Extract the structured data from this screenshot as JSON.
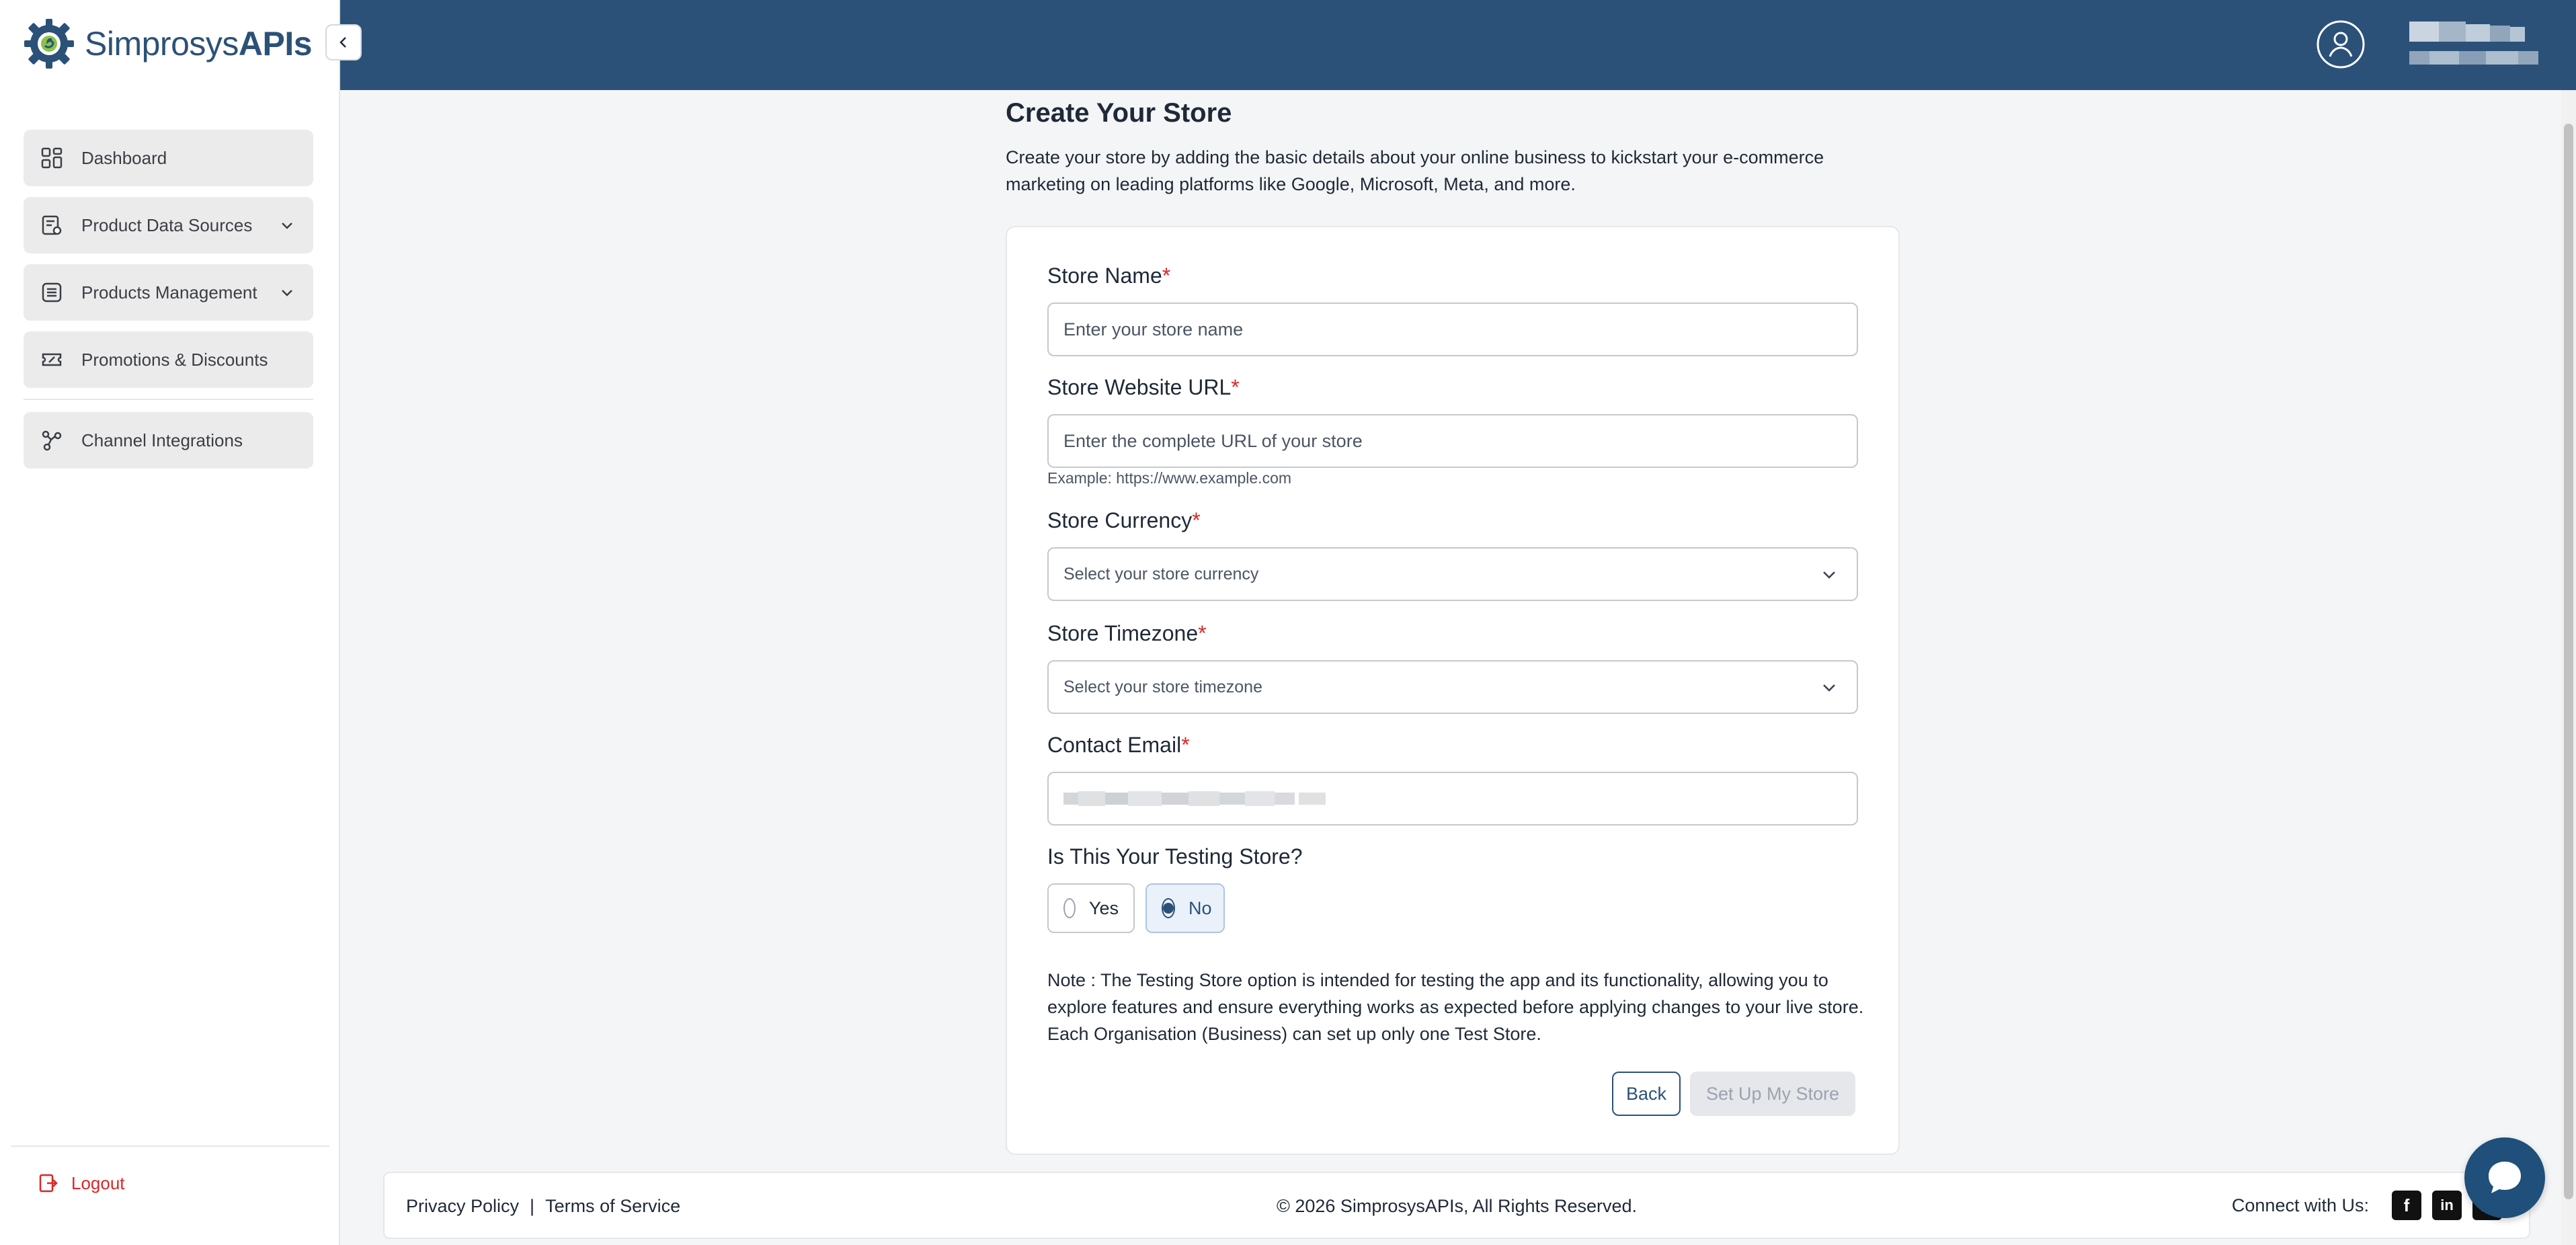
{
  "brand": {
    "name_light": "Simprosys",
    "name_bold": "APIs"
  },
  "sidebar": {
    "items": [
      {
        "label": "Dashboard",
        "icon": "dashboard-icon",
        "expandable": false
      },
      {
        "label": "Product Data Sources",
        "icon": "data-sources-icon",
        "expandable": true
      },
      {
        "label": "Products Management",
        "icon": "products-list-icon",
        "expandable": true
      },
      {
        "label": "Promotions & Discounts",
        "icon": "ticket-icon",
        "expandable": false
      },
      {
        "label": "Channel Integrations",
        "icon": "integrations-icon",
        "expandable": false
      }
    ],
    "logout_label": "Logout"
  },
  "page": {
    "title": "Create Your Store",
    "description": "Create your store by adding the basic details about your online business to kickstart your e-commerce marketing on leading platforms like Google, Microsoft, Meta, and more."
  },
  "form": {
    "required_mark": "*",
    "store_name": {
      "label": "Store Name",
      "placeholder": "Enter your store name"
    },
    "store_url": {
      "label": "Store Website URL",
      "placeholder": "Enter the complete URL of your store",
      "hint": "Example: https://www.example.com"
    },
    "currency": {
      "label": "Store Currency",
      "placeholder": "Select your store currency"
    },
    "timezone": {
      "label": "Store Timezone",
      "placeholder": "Select your store timezone"
    },
    "email": {
      "label": "Contact Email"
    },
    "testing": {
      "label": "Is This Your Testing Store?",
      "options": [
        {
          "label": "Yes",
          "selected": false
        },
        {
          "label": "No",
          "selected": true
        }
      ]
    },
    "note": "Note : The Testing Store option is intended for testing the app and its functionality, allowing you to explore features and ensure everything works as expected before applying changes to your live store. Each Organisation (Business) can set up only one Test Store.",
    "back_label": "Back",
    "setup_label": "Set Up My Store"
  },
  "footer": {
    "privacy": "Privacy Policy",
    "separator": "|",
    "terms": "Terms of Service",
    "copyright": "© 2026 SimprosysAPIs, All Rights Reserved.",
    "connect": "Connect with Us:"
  },
  "colors": {
    "primary": "#2b5179",
    "required": "#dc2626",
    "logout": "#dc2626"
  }
}
